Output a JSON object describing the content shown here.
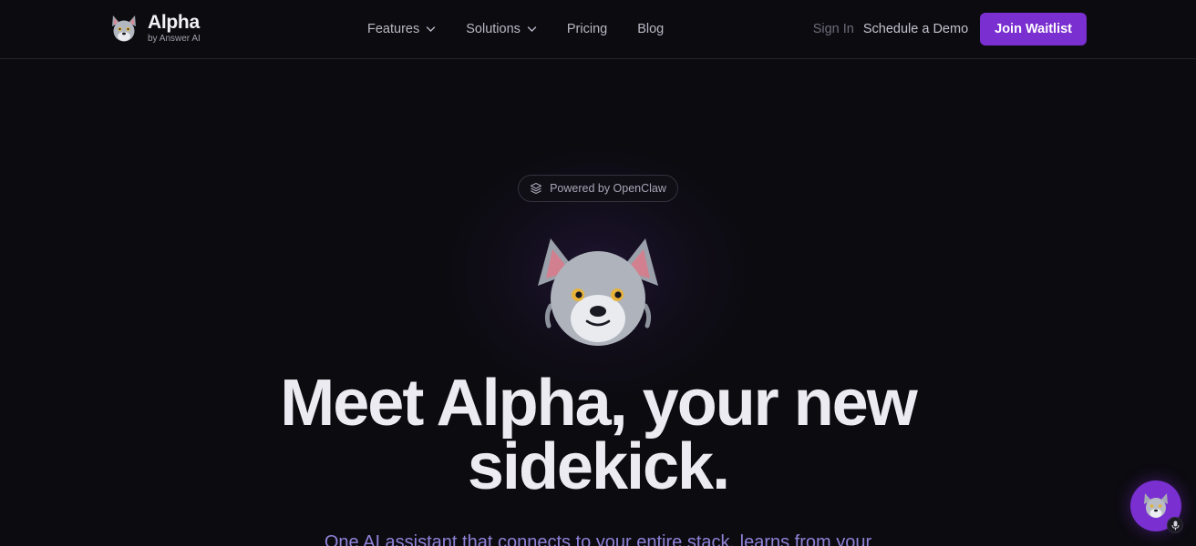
{
  "header": {
    "brand_name": "Alpha",
    "brand_sub": "by Answer AI",
    "nav": [
      {
        "label": "Features",
        "has_dropdown": true
      },
      {
        "label": "Solutions",
        "has_dropdown": true
      },
      {
        "label": "Pricing",
        "has_dropdown": false
      },
      {
        "label": "Blog",
        "has_dropdown": false
      }
    ],
    "sign_in": "Sign In",
    "schedule_demo": "Schedule a Demo",
    "join_waitlist": "Join Waitlist"
  },
  "hero": {
    "badge": "Powered by OpenClaw",
    "headline_line1": "Meet Alpha, your new",
    "headline_line2": "sidekick.",
    "subline": "One AI assistant that connects to your entire stack, learns from your"
  },
  "icons": {
    "logo": "wolf-mascot-icon",
    "badge": "layers-icon",
    "dropdown": "chevron-down-icon",
    "chat": "wolf-mascot-icon",
    "mic": "microphone-icon"
  },
  "colors": {
    "background": "#0c0b10",
    "accent": "#7a2fd0",
    "subline": "#8f83d8"
  }
}
